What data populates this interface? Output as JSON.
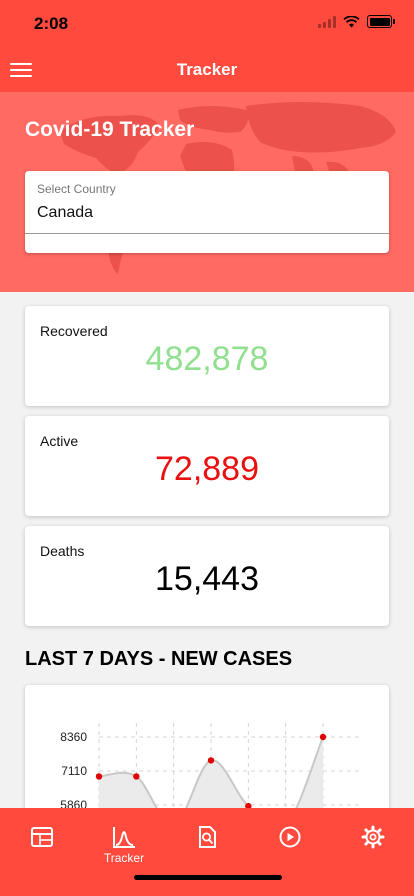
{
  "status_bar": {
    "time": "2:08"
  },
  "app_bar": {
    "title": "Tracker"
  },
  "hero": {
    "title": "Covid-19 Tracker",
    "country_select": {
      "label": "Select Country",
      "value": "Canada"
    }
  },
  "stats": [
    {
      "label": "Recovered",
      "value": "482,878",
      "color": "#90e090"
    },
    {
      "label": "Active",
      "value": "72,889",
      "color": "#e81010"
    },
    {
      "label": "Deaths",
      "value": "15,443",
      "color": "#000000"
    }
  ],
  "section": {
    "title": "LAST 7 DAYS - NEW CASES"
  },
  "chart_data": {
    "type": "line",
    "title": "",
    "xlabel": "",
    "ylabel": "",
    "y_ticks": [
      "8360",
      "7110",
      "5860"
    ],
    "y_tick_values": [
      8360,
      7110,
      5860
    ],
    "values": [
      6910,
      6910,
      5100,
      7500,
      5820,
      5100,
      8360
    ],
    "grid": true,
    "line_color": "#c8c8c8",
    "point_color": "#e00000"
  },
  "tabs": [
    {
      "name": "tab-dashboard",
      "icon": "calendar-icon",
      "label": ""
    },
    {
      "name": "tab-tracker",
      "icon": "chart-curve-icon",
      "label": "Tracker"
    },
    {
      "name": "tab-news",
      "icon": "search-document-icon",
      "label": ""
    },
    {
      "name": "tab-videos",
      "icon": "play-icon",
      "label": ""
    },
    {
      "name": "tab-settings",
      "icon": "gear-icon",
      "label": ""
    }
  ],
  "colors": {
    "primary": "#ff4a3d",
    "hero_bg": "#ff6a62",
    "page_bg": "#f2f2f2"
  }
}
